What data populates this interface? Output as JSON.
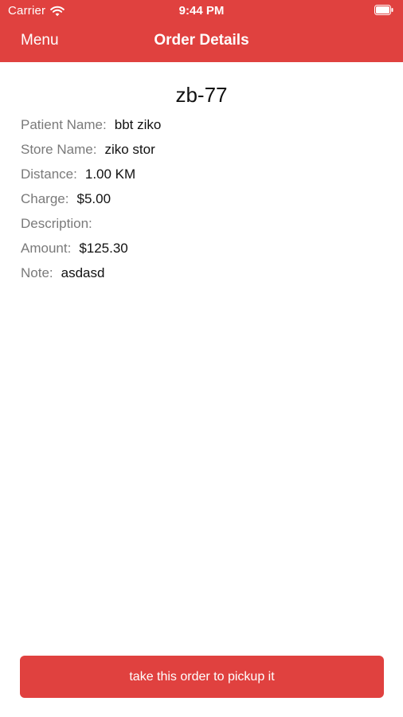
{
  "status_bar": {
    "carrier": "Carrier",
    "time": "9:44 PM"
  },
  "nav": {
    "menu_label": "Menu",
    "title": "Order Details"
  },
  "order": {
    "id": "zb-77",
    "fields": [
      {
        "label": "Patient Name:",
        "value": "bbt ziko"
      },
      {
        "label": "Store Name:",
        "value": "ziko stor"
      },
      {
        "label": "Distance:",
        "value": "1.00 KM"
      },
      {
        "label": "Charge:",
        "value": "$5.00"
      },
      {
        "label": "Description:",
        "value": ""
      },
      {
        "label": "Amount:",
        "value": "$125.30"
      },
      {
        "label": "Note:",
        "value": "asdasd"
      }
    ]
  },
  "action": {
    "label": "take this order to pickup it"
  },
  "colors": {
    "accent": "#e0413f"
  },
  "icons": {
    "wifi": "wifi-icon",
    "battery": "battery-icon"
  }
}
